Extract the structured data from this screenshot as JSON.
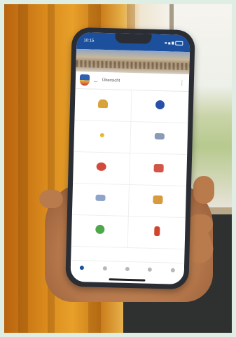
{
  "photo": {
    "subject": "hand holding smartphone showing municipal app"
  },
  "status_bar": {
    "time": "10:15",
    "background": "#1c4f9c"
  },
  "app": {
    "title": "Übersicht",
    "back_icon": "arrow-left-icon",
    "menu_icon": "more-vert-icon",
    "logo_icon": "coat-of-arms-icon"
  },
  "tiles": [
    {
      "label": "",
      "icon": "burger-icon",
      "color": "#d9a23a"
    },
    {
      "label": "",
      "icon": "help-circle-icon",
      "color": "#2a4fa8"
    },
    {
      "label": "",
      "icon": "star-icon",
      "color": "#e6b830"
    },
    {
      "label": "",
      "icon": "bus-icon",
      "color": "#8a9bb8"
    },
    {
      "label": "",
      "icon": "flower-icon",
      "color": "#d24a3a"
    },
    {
      "label": "",
      "icon": "calendar-icon",
      "color": "#d2554a"
    },
    {
      "label": "",
      "icon": "newspaper-icon",
      "color": "#8fa4c8"
    },
    {
      "label": "",
      "icon": "map-icon",
      "color": "#d79a3c"
    },
    {
      "label": "",
      "icon": "recycle-icon",
      "color": "#4ea84a"
    },
    {
      "label": "",
      "icon": "fire-extinguisher-icon",
      "color": "#d0452e"
    }
  ],
  "bottom_nav": [
    {
      "icon": "home-icon",
      "active": true
    },
    {
      "icon": "grid-icon",
      "active": false
    },
    {
      "icon": "bell-icon",
      "active": false
    },
    {
      "icon": "user-icon",
      "active": false
    },
    {
      "icon": "settings-icon",
      "active": false
    }
  ]
}
